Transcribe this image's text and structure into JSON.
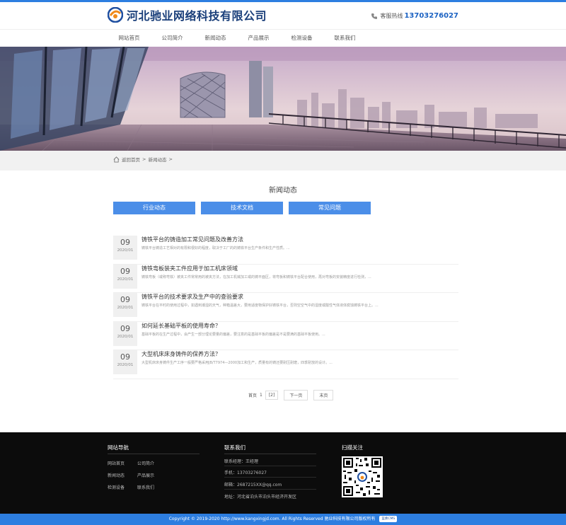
{
  "header": {
    "company_name": "河北驰业网络科技有限公司",
    "hotline_label": "客服热线",
    "hotline_number": "13703276027"
  },
  "nav": {
    "items": [
      {
        "label": "网站首页"
      },
      {
        "label": "公司简介"
      },
      {
        "label": "新闻动态"
      },
      {
        "label": "产品展示"
      },
      {
        "label": "检测设备"
      },
      {
        "label": "联系我们"
      }
    ]
  },
  "breadcrumb": {
    "home": "返回首页",
    "sep": ">",
    "current": "新闻动态"
  },
  "section": {
    "title": "新闻动态"
  },
  "tabs": [
    {
      "label": "行业动态"
    },
    {
      "label": "技术文档"
    },
    {
      "label": "常见问题"
    }
  ],
  "news": [
    {
      "day": "09",
      "ym": "2020/01",
      "title": "铸铁平台的铸造加工常见问题及改善方法",
      "desc": "铸铁平台铸造工艺相对的有限和很好的程度，取决于工厂的的铸铁平台生产条件和生产性质。..."
    },
    {
      "day": "09",
      "ym": "2020/01",
      "title": "铸铁弯板装夹工件应用于加工机床领域",
      "desc": "铸铁弯板（或称弯铁）被夹工件常常用的被夹方法，在加工机械加工或的铸平面区，将弯板和铸铁平台配合使用，再对弯板的安装精度进行检测，..."
    },
    {
      "day": "09",
      "ym": "2020/01",
      "title": "铸铁平台的技术要求及生产中的查验要求",
      "desc": "铸铁平台在平时的使用过程中，如遇到潮湿的天气，种箱温差大，要用适度物保护好铸铁平台，否则空空气中的湿度或酸性气体液体腐蚀铸铁平台上。..."
    },
    {
      "day": "09",
      "ym": "2020/01",
      "title": "如何延长基础平板的使用寿命？",
      "desc": "基础平板的在生产过程中，会产生一部分理论要量的偏差，要注意的是基础平板的偏差是不是要满的基础平板使用。..."
    },
    {
      "day": "09",
      "ym": "2020/01",
      "title": "大型机床床身铸件的保养方法？",
      "desc": "大型机床床身铸件生产工序一般要严格采用JB/T7974—2000加工和生产，质量有的铸还要耐压耐磨，四季耐放的设计。..."
    }
  ],
  "pager": {
    "first": "首页",
    "page_num": "1",
    "current": "[2]",
    "next": "下一页",
    "last": "末页"
  },
  "footer": {
    "col1_title": "网站导航",
    "links": [
      "网站首页",
      "公司简介",
      "新闻动态",
      "产品展示",
      "检测设备",
      "联系我们"
    ],
    "col2_title": "联系我们",
    "contact": [
      "联系经理：王经理",
      "手机：13703276027",
      "邮箱：2687215XX@qq.com",
      "地址：河北省泊头市泊头市经济开发区"
    ],
    "col3_title": "扫描关注"
  },
  "copyright": {
    "text": "Copyright © 2019-2020 http://www.kangxingjd.com. All Rights Reserved 驰业科技有限公司版权所有",
    "badge": "蓝奏CMS"
  },
  "colors": {
    "accent": "#2d7ee0",
    "tab": "#4b8ee8",
    "footer": "#0c0c0c"
  }
}
